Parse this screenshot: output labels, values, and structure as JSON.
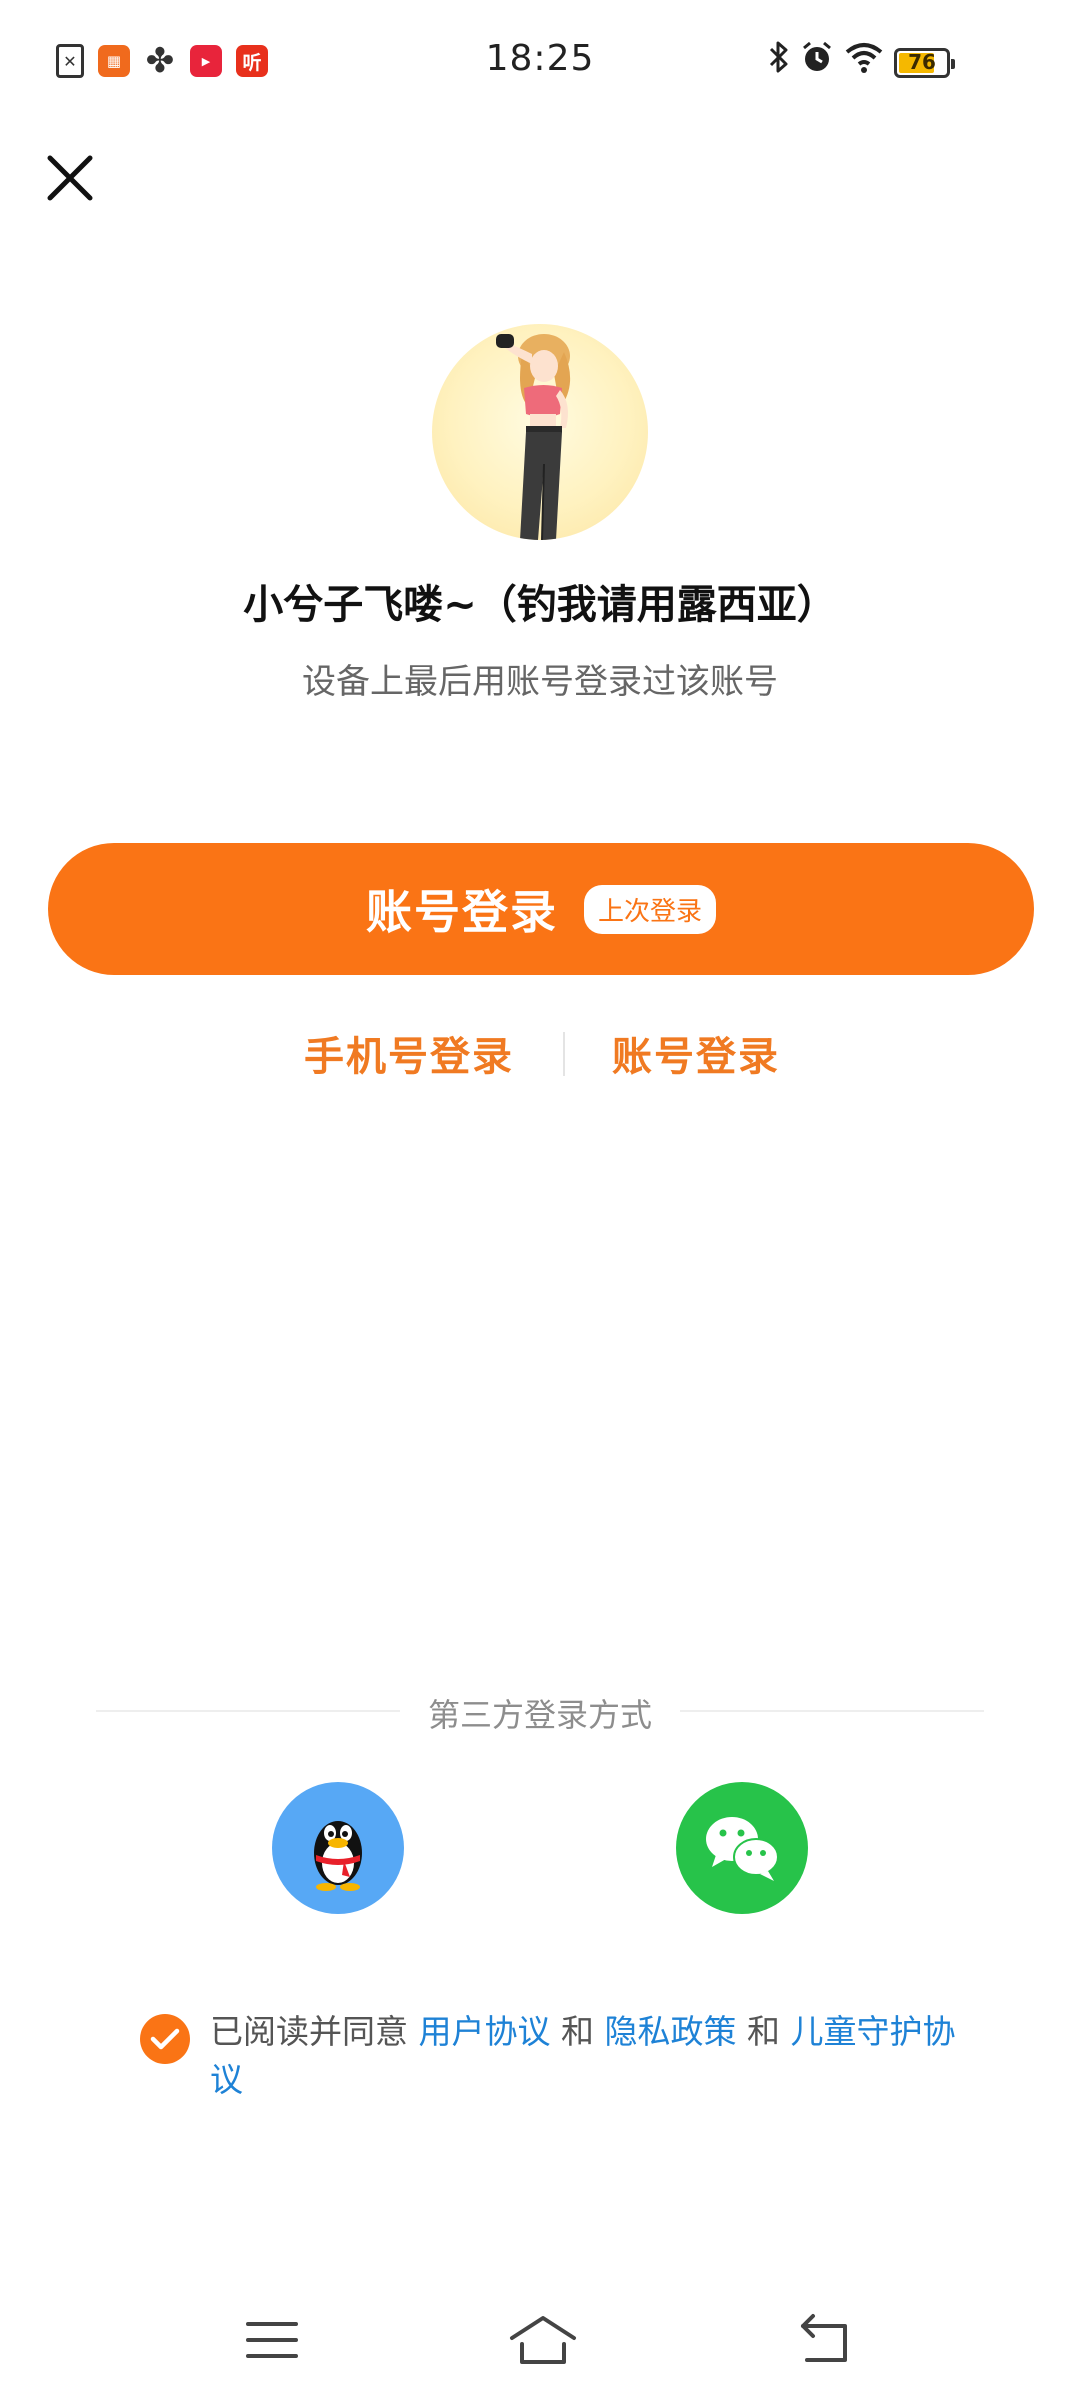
{
  "status_bar": {
    "time": "18:25",
    "battery": "76",
    "battery_level": 0.76,
    "notification_icons": [
      "doc-x",
      "tiles",
      "fan",
      "video",
      "ting"
    ],
    "notification_icon_labels": {
      "ting": "听"
    }
  },
  "profile": {
    "username": "小兮子飞喽~（钓我请用露西亚）",
    "hint": "设备上最后用账号登录过该账号"
  },
  "primary_login": {
    "label": "账号登录",
    "badge": "上次登录"
  },
  "alt_logins": {
    "phone": "手机号登录",
    "account": "账号登录"
  },
  "third_party": {
    "title": "第三方登录方式",
    "providers": [
      "qq",
      "wechat"
    ]
  },
  "agreement": {
    "prefix": "已阅读并同意 ",
    "user_agreement": "用户协议",
    "and1": " 和 ",
    "privacy_policy": "隐私政策",
    "and2": " 和 ",
    "child_protection": "儿童守护协议",
    "checked": true
  },
  "colors": {
    "accent": "#fa7415",
    "link": "#1e82d6",
    "qq": "#57a8f5",
    "wechat": "#27c34a"
  },
  "icons": {
    "close": "close-icon",
    "check": "check-icon",
    "nav_menu": "menu-icon",
    "nav_home": "home-icon",
    "nav_back": "back-icon"
  }
}
